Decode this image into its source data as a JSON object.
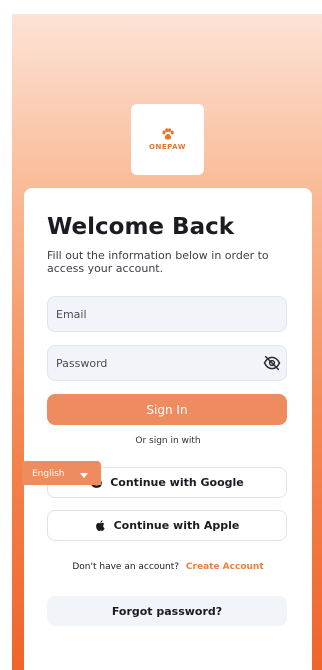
{
  "brand": {
    "name": "ONEPAW",
    "logo_icon": "paw-icon",
    "accent_color": "#ef8c5f",
    "link_color": "#ef7f44"
  },
  "login": {
    "title": "Welcome Back",
    "subtitle": "Fill out the information below in order to access your account.",
    "email": {
      "placeholder": "Email",
      "value": ""
    },
    "password": {
      "placeholder": "Password",
      "value": "",
      "toggle_icon": "eye-off-icon"
    },
    "sign_in_label": "Sign In",
    "or_text": "Or sign in with",
    "google_label": "Continue with Google",
    "apple_label": "Continue with Apple",
    "no_account_text": "Don't have an account?",
    "create_account_label": "Create Account",
    "forgot_label": "Forgot password?"
  },
  "language": {
    "selected": "English",
    "icon": "caret-down-icon"
  }
}
